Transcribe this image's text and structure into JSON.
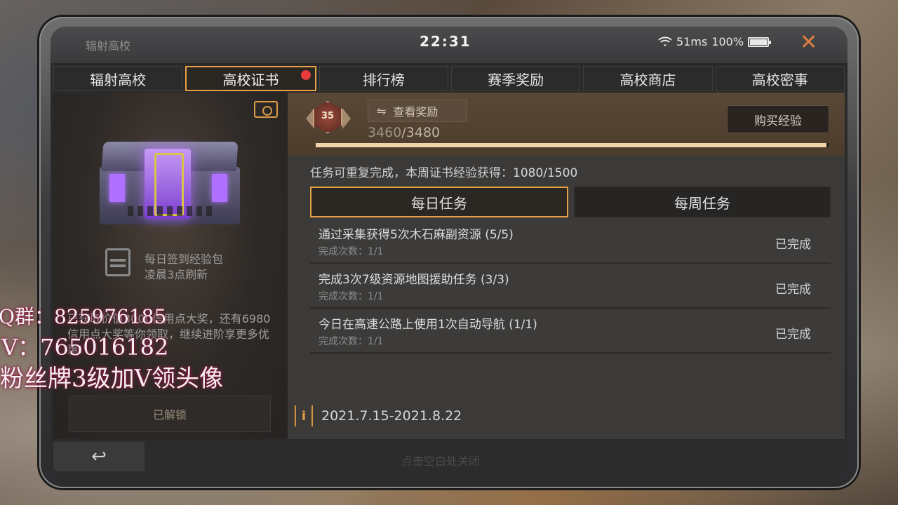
{
  "statusbar": {
    "app_title": "辐射高校",
    "time": "22:31",
    "ping": "51ms",
    "battery": "100%"
  },
  "tabs": [
    {
      "label": "辐射高校",
      "active": false
    },
    {
      "label": "高校证书",
      "active": true,
      "badge": true
    },
    {
      "label": "排行榜",
      "active": false
    },
    {
      "label": "赛季奖励",
      "active": false
    },
    {
      "label": "高校商店",
      "active": false
    },
    {
      "label": "高校密事",
      "active": false
    }
  ],
  "left_panel": {
    "pack_title": "每日签到经验包",
    "pack_subtitle": "凌晨3点刷新",
    "promo_text": "已获取价值3000信用点大奖，还有6980信用点大奖等你领取，继续进阶享更多优惠!",
    "unlock_label": "已解锁"
  },
  "exp": {
    "level": "35",
    "view_reward_label": "查看奖励",
    "current": "3460",
    "max": "/3480",
    "progress": 0.994,
    "buy_label": "购买经验"
  },
  "weekly_note": {
    "label": "任务可重复完成，本周证书经验获得：",
    "value": "1080/1500"
  },
  "subtabs": [
    {
      "label": "每日任务",
      "active": true
    },
    {
      "label": "每周任务",
      "active": false
    }
  ],
  "tasks": [
    {
      "name": "通过采集获得5次木石麻副资源 (5/5)",
      "count": "完成次数：1/1",
      "status": "已完成"
    },
    {
      "name": "完成3次7级资源地图援助任务 (3/3)",
      "count": "完成次数：1/1",
      "status": "已完成"
    },
    {
      "name": "今日在高速公路上使用1次自动导航 (1/1)",
      "count": "完成次数：1/1",
      "status": "已完成"
    }
  ],
  "date_range": "2021.7.15-2021.8.22",
  "bottom": {
    "back_icon": "↩",
    "close_hint": "点击空白处关闭"
  },
  "overlay": {
    "line1": "Q群：825976185",
    "line2": "V：765016182",
    "line3": "粉丝牌3级加V领头像"
  },
  "colors": {
    "accent": "#e8a046",
    "badge": "#e53b3b",
    "close": "#e08040"
  }
}
